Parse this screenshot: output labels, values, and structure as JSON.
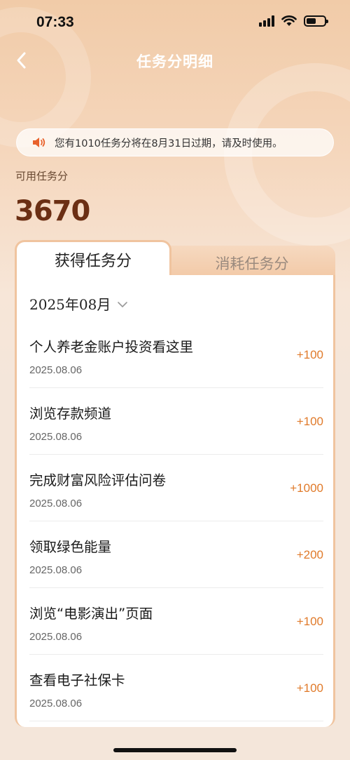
{
  "status_bar": {
    "time": "07:33"
  },
  "nav": {
    "title": "任务分明细"
  },
  "notice": {
    "text": "您有1010任务分将在8月31日过期，请及时使用。"
  },
  "balance": {
    "label": "可用任务分",
    "value": "3670"
  },
  "tabs": [
    {
      "label": "获得任务分",
      "active": true
    },
    {
      "label": "消耗任务分",
      "active": false
    }
  ],
  "filter": {
    "month": "2025年08月"
  },
  "records": [
    {
      "title": "个人养老金账户投资看这里",
      "date": "2025.08.06",
      "points": "+100"
    },
    {
      "title": "浏览存款频道",
      "date": "2025.08.06",
      "points": "+100"
    },
    {
      "title": "完成财富风险评估问卷",
      "date": "2025.08.06",
      "points": "+1000"
    },
    {
      "title": "领取绿色能量",
      "date": "2025.08.06",
      "points": "+200"
    },
    {
      "title": "浏览“电影演出”页面",
      "date": "2025.08.06",
      "points": "+100"
    },
    {
      "title": "查看电子社保卡",
      "date": "2025.08.06",
      "points": "+100"
    }
  ],
  "colors": {
    "accent": "#e07a2a",
    "balance": "#6b2f14",
    "tab_border": "#f0c49f"
  }
}
